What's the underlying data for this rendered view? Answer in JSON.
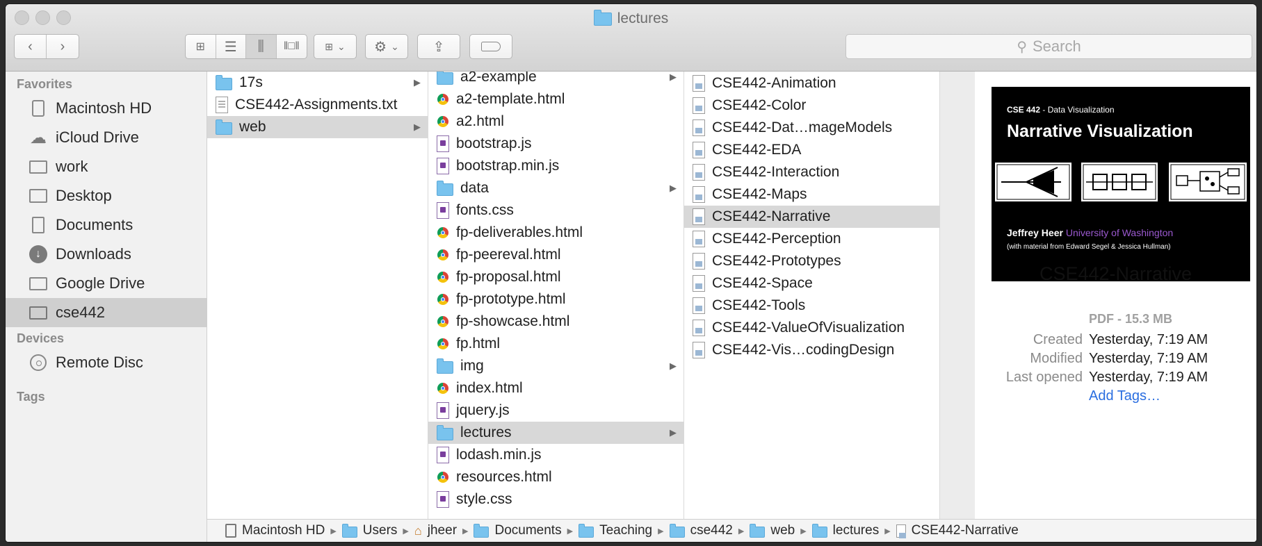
{
  "window": {
    "title": "lectures"
  },
  "toolbar": {
    "search_placeholder": "Search"
  },
  "sidebar": {
    "favorites_heading": "Favorites",
    "favorites": [
      {
        "label": "Macintosh HD",
        "icon": "hard-drive-icon"
      },
      {
        "label": "iCloud Drive",
        "icon": "cloud-icon"
      },
      {
        "label": "work",
        "icon": "folder-icon"
      },
      {
        "label": "Desktop",
        "icon": "desktop-icon"
      },
      {
        "label": "Documents",
        "icon": "documents-icon"
      },
      {
        "label": "Downloads",
        "icon": "download-icon"
      },
      {
        "label": "Google Drive",
        "icon": "folder-icon"
      },
      {
        "label": "cse442",
        "icon": "folder-icon",
        "selected": true
      }
    ],
    "devices_heading": "Devices",
    "devices": [
      {
        "label": "Remote Disc",
        "icon": "disc-icon"
      }
    ],
    "tags_heading": "Tags"
  },
  "columns": {
    "col1": [
      {
        "label": "17s",
        "type": "folder",
        "arrow": true
      },
      {
        "label": "CSE442-Assignments.txt",
        "type": "doc"
      },
      {
        "label": "web",
        "type": "folder",
        "arrow": true,
        "selected": true
      }
    ],
    "col2": [
      {
        "label": "a2-example",
        "type": "folder",
        "arrow": true
      },
      {
        "label": "a2-template.html",
        "type": "html"
      },
      {
        "label": "a2.html",
        "type": "html"
      },
      {
        "label": "bootstrap.js",
        "type": "js"
      },
      {
        "label": "bootstrap.min.js",
        "type": "js"
      },
      {
        "label": "data",
        "type": "folder",
        "arrow": true
      },
      {
        "label": "fonts.css",
        "type": "js"
      },
      {
        "label": "fp-deliverables.html",
        "type": "html"
      },
      {
        "label": "fp-peereval.html",
        "type": "html"
      },
      {
        "label": "fp-proposal.html",
        "type": "html"
      },
      {
        "label": "fp-prototype.html",
        "type": "html"
      },
      {
        "label": "fp-showcase.html",
        "type": "html"
      },
      {
        "label": "fp.html",
        "type": "html"
      },
      {
        "label": "img",
        "type": "folder",
        "arrow": true
      },
      {
        "label": "index.html",
        "type": "html"
      },
      {
        "label": "jquery.js",
        "type": "js"
      },
      {
        "label": "lectures",
        "type": "folder",
        "arrow": true,
        "selected": true
      },
      {
        "label": "lodash.min.js",
        "type": "js"
      },
      {
        "label": "resources.html",
        "type": "html"
      },
      {
        "label": "style.css",
        "type": "js"
      }
    ],
    "col3": [
      {
        "label": "CSE442-Animation"
      },
      {
        "label": "CSE442-Color"
      },
      {
        "label": "CSE442-Dat…mageModels"
      },
      {
        "label": "CSE442-EDA"
      },
      {
        "label": "CSE442-Interaction"
      },
      {
        "label": "CSE442-Maps"
      },
      {
        "label": "CSE442-Narrative",
        "selected": true
      },
      {
        "label": "CSE442-Perception"
      },
      {
        "label": "CSE442-Prototypes"
      },
      {
        "label": "CSE442-Space"
      },
      {
        "label": "CSE442-Tools"
      },
      {
        "label": "CSE442-ValueOfVisualization"
      },
      {
        "label": "CSE442-Vis…codingDesign"
      }
    ]
  },
  "preview": {
    "thumb": {
      "course": "CSE 442",
      "course_suffix": " - Data Visualization",
      "title": "Narrative Visualization",
      "author": "Jeffrey Heer",
      "affiliation": "University of Washington",
      "credit": "(with material from Edward Segel & Jessica Hullman)"
    },
    "filename": "CSE442-Narrative",
    "kind_size": "PDF - 15.3 MB",
    "meta": [
      {
        "label": "Created",
        "value": "Yesterday, 7:19 AM"
      },
      {
        "label": "Modified",
        "value": "Yesterday, 7:19 AM"
      },
      {
        "label": "Last opened",
        "value": "Yesterday, 7:19 AM"
      }
    ],
    "add_tags": "Add Tags…",
    "link_color": "#2a6ee0",
    "accent_color": "#9b59d0"
  },
  "pathbar": [
    {
      "label": "Macintosh HD",
      "icon": "hard-drive-icon"
    },
    {
      "label": "Users",
      "icon": "users-folder-icon"
    },
    {
      "label": "jheer",
      "icon": "home-icon"
    },
    {
      "label": "Documents",
      "icon": "documents-folder-icon"
    },
    {
      "label": "Teaching",
      "icon": "folder-icon"
    },
    {
      "label": "cse442",
      "icon": "folder-icon"
    },
    {
      "label": "web",
      "icon": "folder-icon"
    },
    {
      "label": "lectures",
      "icon": "folder-icon"
    },
    {
      "label": "CSE442-Narrative",
      "icon": "pdf-icon"
    }
  ]
}
